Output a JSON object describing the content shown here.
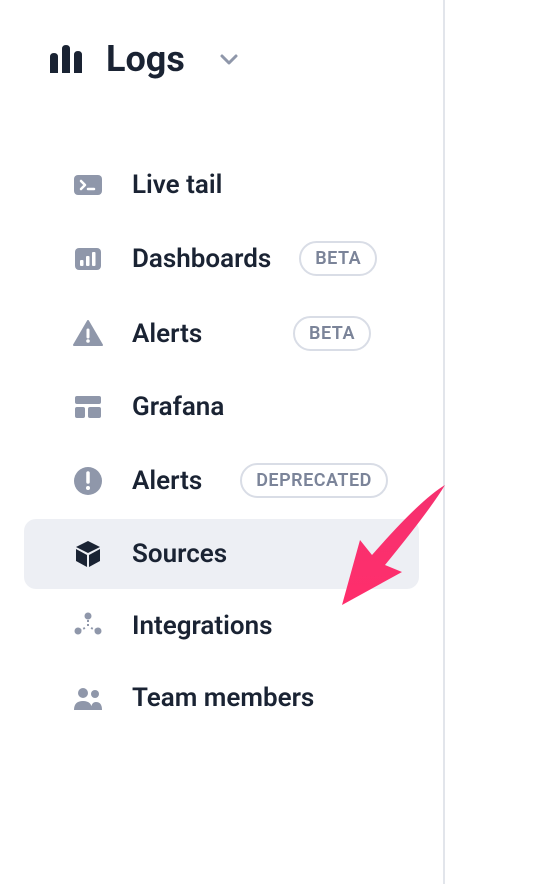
{
  "header": {
    "title": "Logs"
  },
  "nav": {
    "badges": {
      "beta": "BETA",
      "deprecated": "DEPRECATED"
    },
    "items": [
      {
        "label": "Live tail"
      },
      {
        "label": "Dashboards"
      },
      {
        "label": "Alerts"
      },
      {
        "label": "Grafana"
      },
      {
        "label": "Alerts"
      },
      {
        "label": "Sources"
      },
      {
        "label": "Integrations"
      },
      {
        "label": "Team members"
      }
    ]
  },
  "colors": {
    "text": "#1a2333",
    "iconMuted": "#8f97aa",
    "badgeBorder": "#d9dde6",
    "selectedBg": "#edeff4",
    "arrow": "#f5316f"
  }
}
